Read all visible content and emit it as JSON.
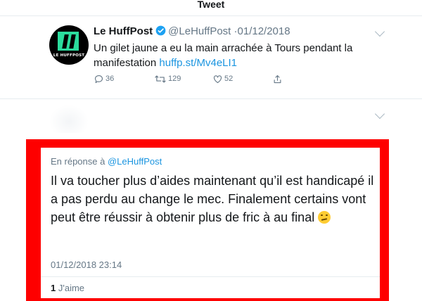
{
  "header": {
    "title": "Tweet"
  },
  "tweet": {
    "author_name": "Le HuffPost",
    "handle": "@LeHuffPost",
    "separator": "·",
    "date": "01/12/2018",
    "text": "Un gilet jaune a eu la main arrachée à Tours pendant la manifestation",
    "link": "huffp.st/Mv4eLI1",
    "avatar_wordmark": "LE HUFFPOST",
    "brand_color": "#2bdc9d",
    "verified_color": "#1da1f2",
    "actions": {
      "replies": "36",
      "retweets": "129",
      "likes": "52"
    },
    "icons": [
      "reply-icon",
      "retweet-icon",
      "like-icon",
      "share-icon",
      "verified-icon",
      "chevron-down-icon"
    ]
  },
  "reply": {
    "in_reply_prefix": "En réponse à",
    "in_reply_handle": "@LeHuffPost",
    "text": "Il va toucher plus d’aides maintenant qu’il est handicapé il a pas perdu au change le mec. Finalement certains vont peut être réussir à obtenir plus de fric à au final",
    "emoji": "thinking-face",
    "timestamp": "01/12/2018 23:14",
    "like_count": "1",
    "like_label": "J'aime",
    "highlight_color": "#fe0000"
  }
}
